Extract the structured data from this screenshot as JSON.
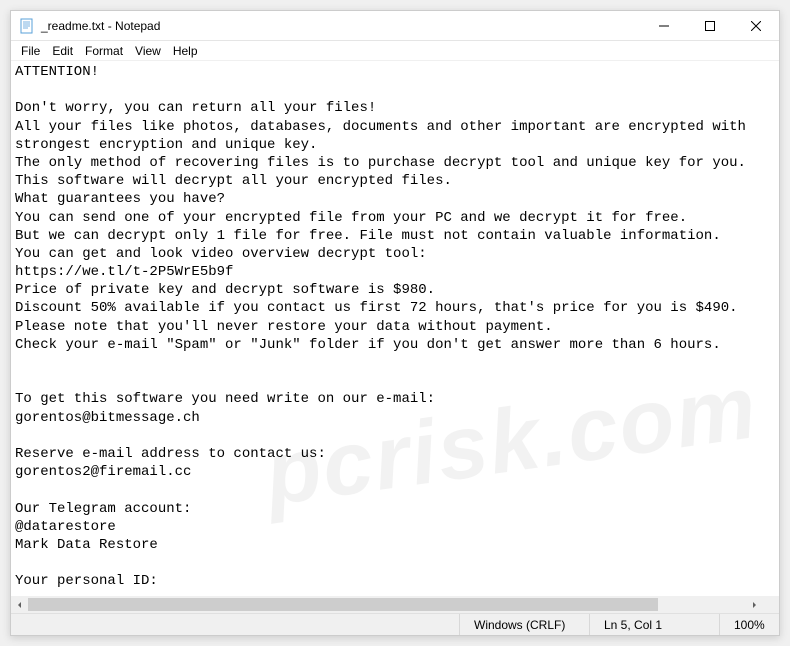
{
  "window": {
    "title": "_readme.txt - Notepad"
  },
  "menubar": {
    "file": "File",
    "edit": "Edit",
    "format": "Format",
    "view": "View",
    "help": "Help"
  },
  "content": "ATTENTION!\n\nDon't worry, you can return all your files!\nAll your files like photos, databases, documents and other important are encrypted with\nstrongest encryption and unique key.\nThe only method of recovering files is to purchase decrypt tool and unique key for you.\nThis software will decrypt all your encrypted files.\nWhat guarantees you have?\nYou can send one of your encrypted file from your PC and we decrypt it for free.\nBut we can decrypt only 1 file for free. File must not contain valuable information.\nYou can get and look video overview decrypt tool:\nhttps://we.tl/t-2P5WrE5b9f\nPrice of private key and decrypt software is $980.\nDiscount 50% available if you contact us first 72 hours, that's price for you is $490.\nPlease note that you'll never restore your data without payment.\nCheck your e-mail \"Spam\" or \"Junk\" folder if you don't get answer more than 6 hours.\n\n\nTo get this software you need write on our e-mail:\ngorentos@bitmessage.ch\n\nReserve e-mail address to contact us:\ngorentos2@firemail.cc\n\nOur Telegram account:\n@datarestore\nMark Data Restore\n\nYour personal ID:\n-",
  "statusbar": {
    "encoding": "Windows (CRLF)",
    "position": "Ln 5, Col 1",
    "zoom": "100%"
  },
  "watermark": "pcrisk.com"
}
